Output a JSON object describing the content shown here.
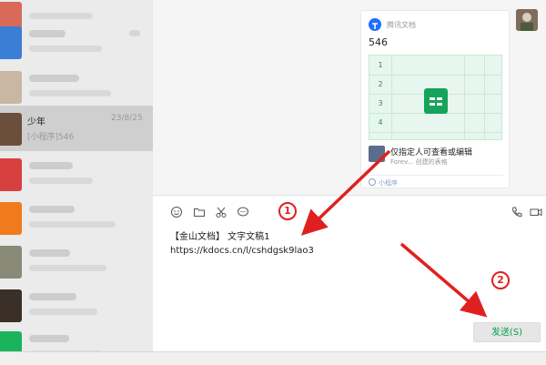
{
  "chat_list": {
    "selected": {
      "name": "少年",
      "time": "23/8/25",
      "preview": "[小程序]546"
    }
  },
  "card": {
    "source": "腾讯文档",
    "title": "546",
    "rows": [
      "1",
      "2",
      "3",
      "4"
    ],
    "access_title": "仅指定人可查看或编辑",
    "access_sub": "Forev... 创建的表格",
    "footer": "小程序"
  },
  "toolbar": {
    "emoji_icon": "emoji-icon",
    "folder_icon": "folder-icon",
    "scissors_icon": "scissors-icon",
    "chat_icon": "chat-bubble-icon",
    "phone_icon": "phone-icon",
    "video_icon": "video-icon"
  },
  "input": {
    "line1": "【金山文档】 文字文稿1",
    "line2": "https://kdocs.cn/l/cshdgsk9lao3"
  },
  "send_label": "发送(S)",
  "annotations": {
    "step1": "1",
    "step2": "2",
    "color": "#e02020"
  }
}
